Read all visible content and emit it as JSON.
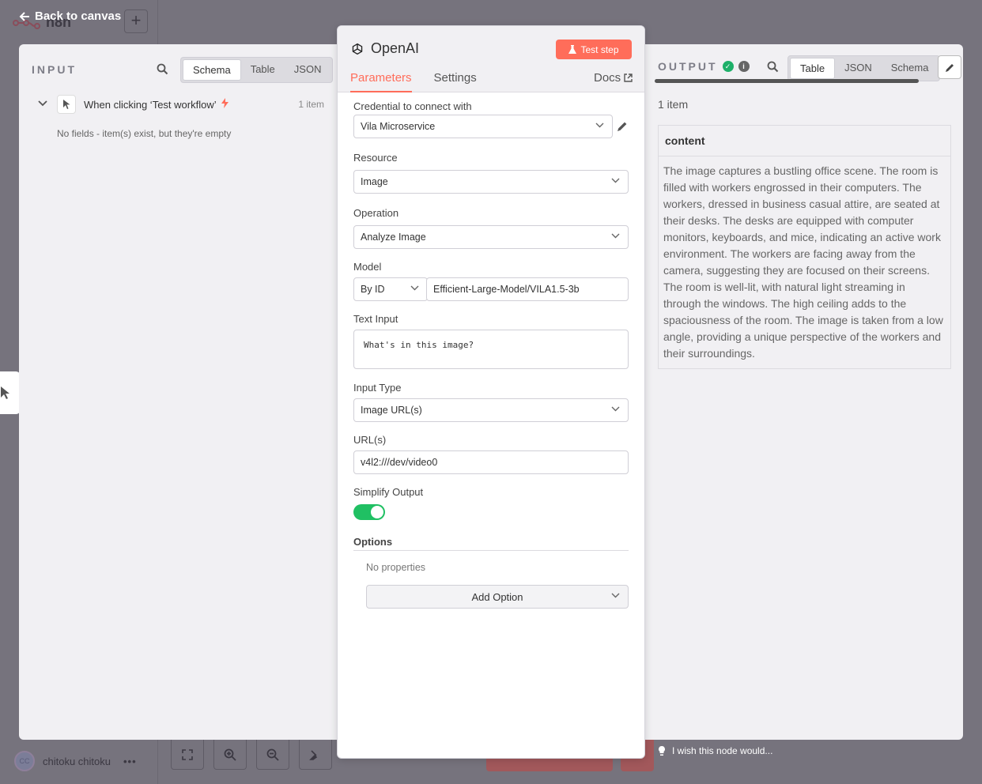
{
  "canvas": {
    "logo_text": "n8n",
    "back_label": "Back to canvas",
    "user_initials": "CC",
    "user_name": "chitoku chitoku",
    "user_menu": "•••",
    "feedback_text": "I wish this node would..."
  },
  "input": {
    "title": "INPUT",
    "tabs": [
      "Schema",
      "Table",
      "JSON"
    ],
    "active_tab": "Schema",
    "trigger_label": "When clicking ‘Test workflow’",
    "trigger_count": "1 item",
    "empty_message": "No fields - item(s) exist, but they're empty"
  },
  "node": {
    "title": "OpenAI",
    "test_button": "Test step",
    "tabs": [
      "Parameters",
      "Settings"
    ],
    "active_tab": "Parameters",
    "docs_label": "Docs",
    "fields": {
      "credential_label": "Credential to connect with",
      "credential_value": "Vila Microservice",
      "resource_label": "Resource",
      "resource_value": "Image",
      "operation_label": "Operation",
      "operation_value": "Analyze Image",
      "model_label": "Model",
      "model_mode": "By ID",
      "model_value": "Efficient-Large-Model/VILA1.5-3b",
      "text_input_label": "Text Input",
      "text_input_value": "What's in this image?",
      "input_type_label": "Input Type",
      "input_type_value": "Image URL(s)",
      "urls_label": "URL(s)",
      "urls_value": "v4l2:///dev/video0",
      "simplify_label": "Simplify Output",
      "simplify_on": true,
      "options_label": "Options",
      "no_properties": "No properties",
      "add_option": "Add Option"
    }
  },
  "output": {
    "title": "OUTPUT",
    "tabs": [
      "Table",
      "JSON",
      "Schema"
    ],
    "active_tab": "Table",
    "count": "1 item",
    "column": "content",
    "content": "The image captures a bustling office scene. The room is filled with workers engrossed in their computers. The workers, dressed in business casual attire, are seated at their desks. The desks are equipped with computer monitors, keyboards, and mice, indicating an active work environment. The workers are facing away from the camera, suggesting they are focused on their screens. The room is well-lit, with natural light streaming in through the windows. The high ceiling adds to the spaciousness of the room. The image is taken from a low angle, providing a unique perspective of the workers and their surroundings."
  },
  "colors": {
    "accent": "#ff6d5a",
    "success": "#1eb069",
    "toggle_on": "#20c063"
  }
}
